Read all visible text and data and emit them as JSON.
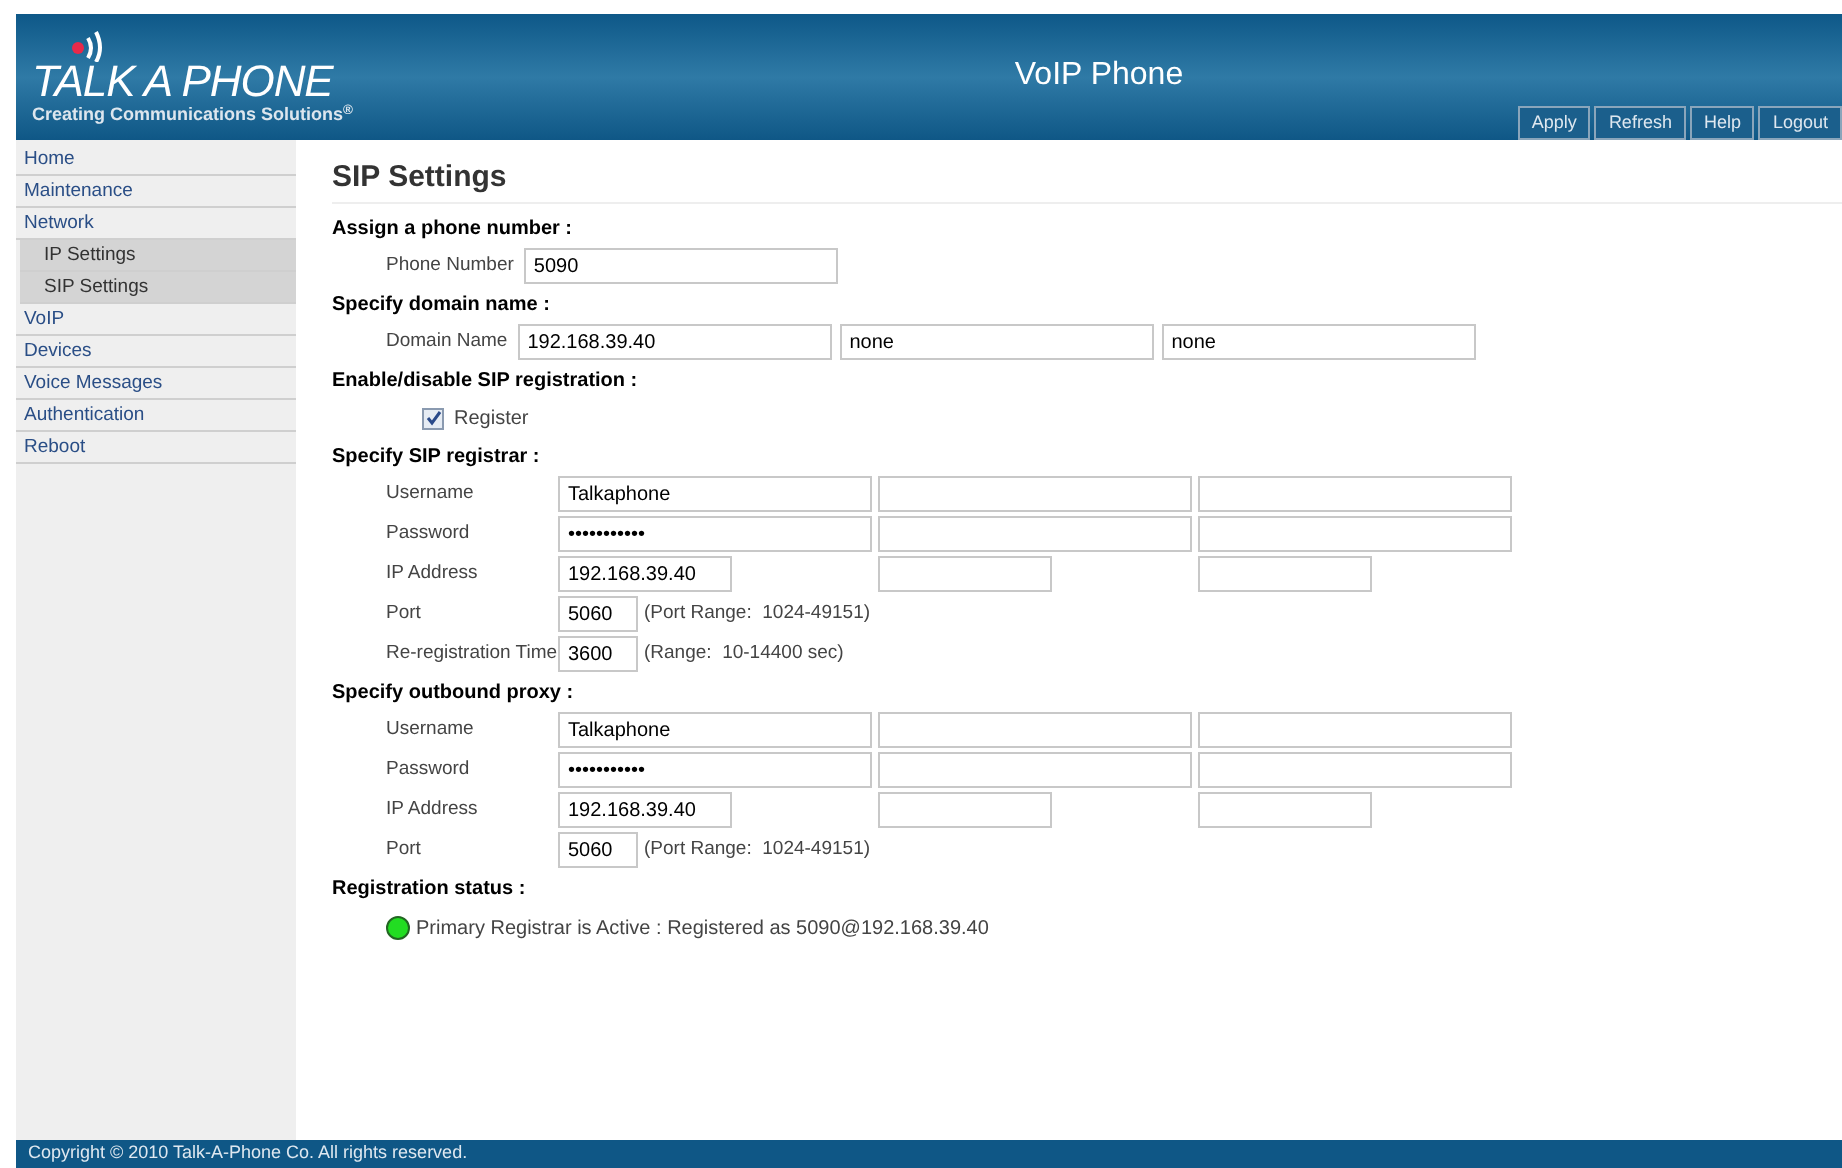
{
  "header": {
    "logo_text": "TALK A PHONE",
    "logo_tagline": "Creating Communications Solutions",
    "logo_mark": "®",
    "title": "VoIP Phone",
    "buttons": [
      "Apply",
      "Refresh",
      "Help",
      "Logout"
    ]
  },
  "sidebar": {
    "items": [
      {
        "label": "Home"
      },
      {
        "label": "Maintenance"
      },
      {
        "label": "Network",
        "children": [
          {
            "label": "IP Settings"
          },
          {
            "label": "SIP Settings"
          }
        ]
      },
      {
        "label": "VoIP"
      },
      {
        "label": "Devices"
      },
      {
        "label": "Voice Messages"
      },
      {
        "label": "Authentication"
      },
      {
        "label": "Reboot"
      }
    ]
  },
  "page_title": "SIP Settings",
  "sections": [
    {
      "kind": "inline",
      "heading": "Assign a phone number :",
      "rows": [
        {
          "label": "Phone Number",
          "inputs": [
            {
              "kind": "wide",
              "value": "5090"
            }
          ]
        }
      ]
    },
    {
      "kind": "inline",
      "heading": "Specify domain name :",
      "rows": [
        {
          "label": "Domain Name",
          "inputs": [
            {
              "kind": "wide",
              "value": "192.168.39.40"
            },
            {
              "kind": "wide",
              "value": "none"
            },
            {
              "kind": "wide",
              "value": "none"
            }
          ]
        }
      ]
    },
    {
      "kind": "checkbox",
      "heading": "Enable/disable SIP registration :",
      "label": "Register",
      "checked": true
    },
    {
      "kind": "grid",
      "heading": "Specify SIP registrar :",
      "rows": [
        {
          "label": "Username",
          "inputs": [
            {
              "kind": "wide",
              "value": "Talkaphone"
            },
            {
              "kind": "wide"
            },
            {
              "kind": "wide"
            }
          ]
        },
        {
          "label": "Password",
          "inputs": [
            {
              "kind": "wide",
              "value": "•••••••••••"
            },
            {
              "kind": "wide"
            },
            {
              "kind": "wide"
            }
          ]
        },
        {
          "label": "IP Address",
          "inputs": [
            {
              "kind": "medium",
              "value": "192.168.39.40"
            },
            {
              "kind": "medium"
            },
            {
              "kind": "medium"
            }
          ]
        },
        {
          "label": "Port",
          "inputs": [
            {
              "kind": "short",
              "value": "5060"
            }
          ],
          "note": "(Port Range:  1024-49151)"
        },
        {
          "label": "Re-registration Time",
          "inputs": [
            {
              "kind": "short",
              "value": "3600"
            }
          ],
          "note": "(Range:  10-14400 sec)"
        }
      ]
    },
    {
      "kind": "grid",
      "heading": "Specify outbound proxy :",
      "rows": [
        {
          "label": "Username",
          "inputs": [
            {
              "kind": "wide",
              "value": "Talkaphone"
            },
            {
              "kind": "wide"
            },
            {
              "kind": "wide"
            }
          ]
        },
        {
          "label": "Password",
          "inputs": [
            {
              "kind": "wide",
              "value": "•••••••••••"
            },
            {
              "kind": "wide"
            },
            {
              "kind": "wide"
            }
          ]
        },
        {
          "label": "IP Address",
          "inputs": [
            {
              "kind": "medium",
              "value": "192.168.39.40"
            },
            {
              "kind": "medium"
            },
            {
              "kind": "medium"
            }
          ]
        },
        {
          "label": "Port",
          "inputs": [
            {
              "kind": "short",
              "value": "5060"
            }
          ],
          "note": "(Port Range:  1024-49151)"
        }
      ]
    },
    {
      "kind": "status",
      "heading": "Registration status :",
      "color": "#22dd22",
      "text": "Primary Registrar is Active : Registered as 5090@192.168.39.40"
    }
  ],
  "footer": "Copyright © 2010 Talk-A-Phone Co. All rights reserved."
}
